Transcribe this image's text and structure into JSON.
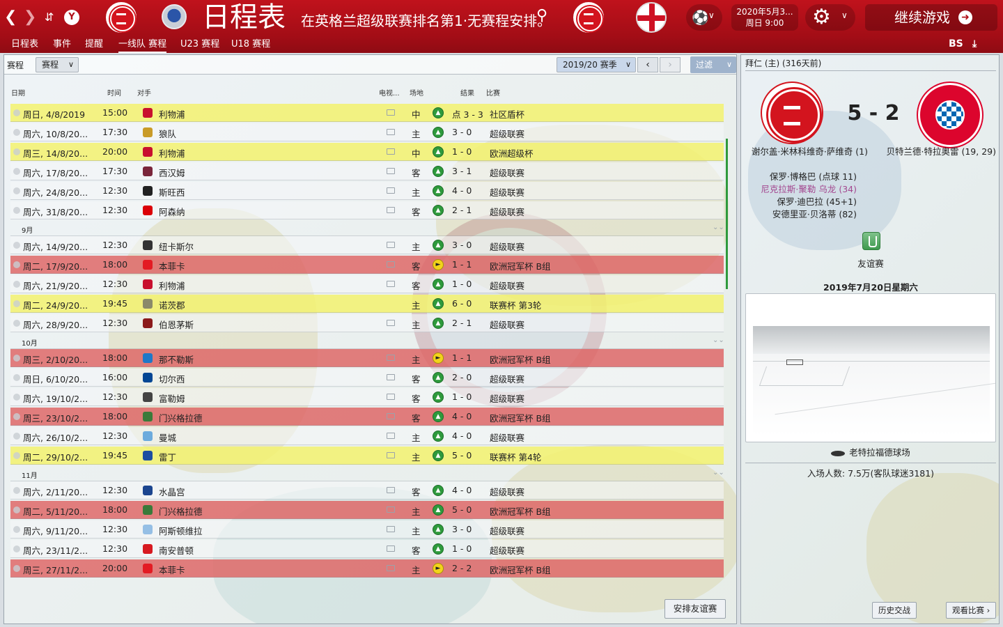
{
  "header": {
    "back_icon": "chevron-left-icon",
    "forward_icon": "chevron-right-icon",
    "title": "日程表",
    "subtitle": "在英格兰超级联赛排名第1·无赛程安排。",
    "date_line1": "2020年5月3...",
    "date_line2": "周日 9:00",
    "continue_label": "继续游戏",
    "accent": "#b10f18"
  },
  "subtabs": [
    "日程表",
    "事件",
    "提醒",
    "一线队 赛程",
    "U23 赛程",
    "U18 赛程"
  ],
  "toolbar": {
    "label": "赛程",
    "view_select": "赛程",
    "season_select": "2019/20 赛季",
    "filter_label": "过滤"
  },
  "columns": {
    "date": "日期",
    "time": "时间",
    "opponent": "对手",
    "tv": "电视...",
    "venue": "场地",
    "result": "结果",
    "competition": "比赛"
  },
  "fixtures": [
    {
      "type": "match",
      "style": "yellow",
      "date": "周日, 4/8/2019",
      "time": "15:00",
      "opp": "利物浦",
      "crest": "#c8102e",
      "tv": true,
      "venue": "中",
      "res": "A",
      "score": "点 3 - 3",
      "comp": "社区盾杯"
    },
    {
      "type": "match",
      "style": "plain",
      "date": "周六, 10/8/20...",
      "time": "17:30",
      "opp": "狼队",
      "crest": "#c99b28",
      "tv": true,
      "venue": "主",
      "res": "A",
      "score": "3 - 0",
      "comp": "超级联赛"
    },
    {
      "type": "match",
      "style": "yellow",
      "date": "周三, 14/8/20...",
      "time": "20:00",
      "opp": "利物浦",
      "crest": "#c8102e",
      "tv": true,
      "venue": "中",
      "res": "A",
      "score": "1 - 0",
      "comp": "欧洲超级杯"
    },
    {
      "type": "match",
      "style": "plain",
      "date": "周六, 17/8/20...",
      "time": "17:30",
      "opp": "西汉姆",
      "crest": "#7a263a",
      "tv": true,
      "venue": "客",
      "res": "A",
      "score": "3 - 1",
      "comp": "超级联赛"
    },
    {
      "type": "match",
      "style": "plain",
      "date": "周六, 24/8/20...",
      "time": "12:30",
      "opp": "斯旺西",
      "crest": "#222222",
      "tv": true,
      "venue": "主",
      "res": "A",
      "score": "4 - 0",
      "comp": "超级联赛"
    },
    {
      "type": "match",
      "style": "plain",
      "date": "周六, 31/8/20...",
      "time": "12:30",
      "opp": "阿森纳",
      "crest": "#db0007",
      "tv": true,
      "venue": "客",
      "res": "A",
      "score": "2 - 1",
      "comp": "超级联赛"
    },
    {
      "type": "month",
      "label": "9月"
    },
    {
      "type": "match",
      "style": "plain",
      "date": "周六, 14/9/20...",
      "time": "12:30",
      "opp": "纽卡斯尔",
      "crest": "#333333",
      "tv": true,
      "venue": "主",
      "res": "A",
      "score": "3 - 0",
      "comp": "超级联赛"
    },
    {
      "type": "match",
      "style": "red",
      "date": "周二, 17/9/20...",
      "time": "18:00",
      "opp": "本菲卡",
      "crest": "#e31b23",
      "tv": true,
      "venue": "客",
      "res": "D",
      "score": "1 - 1",
      "comp": "欧洲冠军杯 B组"
    },
    {
      "type": "match",
      "style": "plain",
      "date": "周六, 21/9/20...",
      "time": "12:30",
      "opp": "利物浦",
      "crest": "#c8102e",
      "tv": true,
      "venue": "客",
      "res": "A",
      "score": "1 - 0",
      "comp": "超级联赛"
    },
    {
      "type": "match",
      "style": "yellow",
      "date": "周二, 24/9/20...",
      "time": "19:45",
      "opp": "诺茨郡",
      "crest": "#8a8a6a",
      "tv": false,
      "venue": "主",
      "res": "A",
      "score": "6 - 0",
      "comp": "联赛杯 第3轮"
    },
    {
      "type": "match",
      "style": "plain",
      "date": "周六, 28/9/20...",
      "time": "12:30",
      "opp": "伯恩茅斯",
      "crest": "#8b1a1a",
      "tv": true,
      "venue": "主",
      "res": "A",
      "score": "2 - 1",
      "comp": "超级联赛"
    },
    {
      "type": "month",
      "label": "10月"
    },
    {
      "type": "match",
      "style": "red",
      "date": "周三, 2/10/20...",
      "time": "18:00",
      "opp": "那不勒斯",
      "crest": "#1f78c8",
      "tv": true,
      "venue": "主",
      "res": "D",
      "score": "1 - 1",
      "comp": "欧洲冠军杯 B组"
    },
    {
      "type": "match",
      "style": "plain",
      "date": "周日, 6/10/20...",
      "time": "16:00",
      "opp": "切尔西",
      "crest": "#034694",
      "tv": true,
      "venue": "客",
      "res": "A",
      "score": "2 - 0",
      "comp": "超级联赛"
    },
    {
      "type": "match",
      "style": "plain",
      "date": "周六, 19/10/2...",
      "time": "12:30",
      "opp": "富勒姆",
      "crest": "#444444",
      "tv": true,
      "venue": "客",
      "res": "A",
      "score": "1 - 0",
      "comp": "超级联赛"
    },
    {
      "type": "match",
      "style": "red",
      "date": "周三, 23/10/2...",
      "time": "18:00",
      "opp": "门兴格拉德",
      "crest": "#3a7a3a",
      "tv": true,
      "venue": "客",
      "res": "A",
      "score": "4 - 0",
      "comp": "欧洲冠军杯 B组"
    },
    {
      "type": "match",
      "style": "plain",
      "date": "周六, 26/10/2...",
      "time": "12:30",
      "opp": "曼城",
      "crest": "#6cabdd",
      "tv": true,
      "venue": "主",
      "res": "A",
      "score": "4 - 0",
      "comp": "超级联赛"
    },
    {
      "type": "match",
      "style": "yellow",
      "date": "周二, 29/10/2...",
      "time": "19:45",
      "opp": "雷丁",
      "crest": "#1d4ea1",
      "tv": true,
      "venue": "主",
      "res": "A",
      "score": "5 - 0",
      "comp": "联赛杯 第4轮"
    },
    {
      "type": "month",
      "label": "11月"
    },
    {
      "type": "match",
      "style": "plain",
      "date": "周六, 2/11/20...",
      "time": "12:30",
      "opp": "水晶宫",
      "crest": "#1b458f",
      "tv": true,
      "venue": "客",
      "res": "A",
      "score": "4 - 0",
      "comp": "超级联赛"
    },
    {
      "type": "match",
      "style": "red",
      "date": "周二, 5/11/20...",
      "time": "18:00",
      "opp": "门兴格拉德",
      "crest": "#3a7a3a",
      "tv": true,
      "venue": "主",
      "res": "A",
      "score": "5 - 0",
      "comp": "欧洲冠军杯 B组"
    },
    {
      "type": "match",
      "style": "plain",
      "date": "周六, 9/11/20...",
      "time": "12:30",
      "opp": "阿斯顿维拉",
      "crest": "#95bfe5",
      "tv": true,
      "venue": "主",
      "res": "A",
      "score": "3 - 0",
      "comp": "超级联赛"
    },
    {
      "type": "match",
      "style": "plain",
      "date": "周六, 23/11/2...",
      "time": "12:30",
      "opp": "南安普顿",
      "crest": "#d71920",
      "tv": true,
      "venue": "客",
      "res": "A",
      "score": "1 - 0",
      "comp": "超级联赛"
    },
    {
      "type": "match",
      "style": "red",
      "date": "周三, 27/11/2...",
      "time": "20:00",
      "opp": "本菲卡",
      "crest": "#e31b23",
      "tv": true,
      "venue": "主",
      "res": "D",
      "score": "2 - 2",
      "comp": "欧洲冠军杯 B组"
    }
  ],
  "actions": {
    "arrange_friendly": "安排友谊赛"
  },
  "match_detail": {
    "header": "拜仁 (主) (316天前)",
    "score": "5 - 2",
    "home_team": "谢尔盖·米林科维奇·萨维奇 (1)",
    "away_team": "贝特兰德·特拉奥雷 (19, 29)",
    "scorers": [
      {
        "text": "保罗·博格巴 (点球 11)",
        "highlight": false
      },
      {
        "text": "尼克拉斯·聚勒 乌龙 (34)",
        "highlight": true
      },
      {
        "text": "保罗·迪巴拉 (45+1)",
        "highlight": false
      },
      {
        "text": "安德里亚·贝洛蒂 (82)",
        "highlight": false
      }
    ],
    "competition": "友谊赛",
    "date": "2019年7月20日星期六",
    "stadium": "老特拉福德球场",
    "attendance": "入场人数: 7.5万(客队球迷3181)",
    "history_button": "历史交战",
    "details_button": "观看比赛"
  }
}
